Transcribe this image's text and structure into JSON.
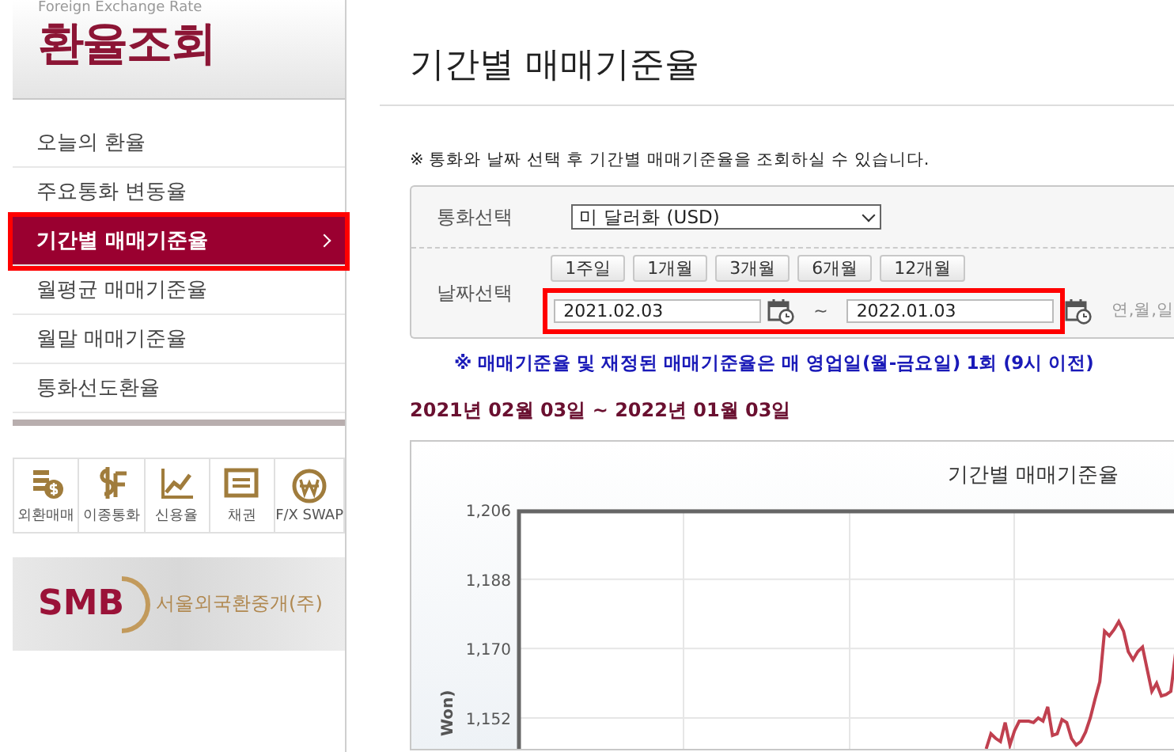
{
  "sidebar": {
    "header_subtitle": "Foreign Exchange Rate",
    "header_title": "환율조회",
    "menu": [
      {
        "label": "오늘의 환율",
        "selected": false,
        "highlighted": false
      },
      {
        "label": "주요통화 변동율",
        "selected": false,
        "highlighted": false
      },
      {
        "label": "기간별 매매기준율",
        "selected": true,
        "highlighted": true
      },
      {
        "label": "월평균 매매기준율",
        "selected": false,
        "highlighted": false
      },
      {
        "label": "월말 매매기준율",
        "selected": false,
        "highlighted": false
      },
      {
        "label": "통화선도환율",
        "selected": false,
        "highlighted": false
      }
    ],
    "quick_links": [
      {
        "label": "외환매매",
        "kind": "coins"
      },
      {
        "label": "이종통화",
        "kind": "currency"
      },
      {
        "label": "신용율",
        "kind": "chart"
      },
      {
        "label": "채권",
        "kind": "document"
      },
      {
        "label": "F/X SWAP",
        "kind": "won"
      }
    ],
    "banner": {
      "logo": "SMB",
      "name": "서울외국환중개(주)"
    }
  },
  "main": {
    "title": "기간별 매매기준율",
    "note": "※ 통화와 날짜 선택 후 기간별 매매기준율을 조회하실 수 있습니다.",
    "form": {
      "currency_label": "통화선택",
      "currency_value": "미 달러화 (USD)",
      "date_label": "날짜선택",
      "period_buttons": [
        "1주일",
        "1개월",
        "3개월",
        "6개월",
        "12개월"
      ],
      "start_date": "2021.02.03",
      "separator": "~",
      "end_date": "2022.01.03",
      "date_hint": "연,월,일",
      "dates_highlighted": true
    },
    "notice": "※ 매매기준율 및 재정된 매매기준율은 매 영업일(월-금요일) 1회 (9시 이전)",
    "range_text": "2021년 02월 03일 ~ 2022년 01월 03일",
    "chart": {
      "chart_data": {
        "type": "line",
        "title": "기간별 매매기준율",
        "ylabel": "Won)",
        "grid": true,
        "ylim": [
          1144,
          1206
        ],
        "yticks": [
          {
            "value": 1152,
            "label": "1,152"
          },
          {
            "value": 1170,
            "label": "1,170"
          },
          {
            "value": 1188,
            "label": "1,188"
          },
          {
            "value": 1206,
            "label": "1,206"
          }
        ],
        "categories": [
          null,
          null,
          null,
          null,
          null,
          null,
          null,
          null,
          null,
          null,
          null,
          null,
          null,
          null,
          null,
          null,
          null,
          null,
          null,
          null,
          null,
          null,
          null,
          null,
          null,
          null,
          null,
          null,
          null,
          null,
          null,
          null,
          null,
          null,
          null,
          null,
          null,
          null,
          null,
          null,
          null,
          null,
          null,
          null,
          null,
          null,
          null,
          null,
          null,
          null,
          null,
          null,
          null,
          null,
          null,
          null,
          null,
          null,
          null,
          null,
          null,
          null,
          null,
          null,
          null,
          null,
          null,
          null,
          null,
          null,
          null,
          null,
          null,
          null,
          null,
          null,
          null,
          null,
          null,
          null,
          null,
          null,
          null,
          null,
          null,
          null,
          null,
          null,
          null,
          null,
          null,
          null,
          null,
          null,
          null,
          null,
          null,
          null,
          null,
          null,
          null,
          null,
          null,
          null,
          null,
          null,
          null,
          null,
          null,
          null,
          null,
          null,
          null,
          null,
          null,
          null,
          null,
          null,
          null,
          null,
          null,
          null,
          null,
          null,
          null,
          null,
          null,
          null,
          null,
          null,
          null,
          null,
          null,
          null,
          null,
          null,
          null,
          null,
          null,
          null
        ],
        "series": [
          {
            "color": "#c0404f",
            "values": [
              null,
              null,
              null,
              null,
              null,
              null,
              null,
              null,
              null,
              null,
              null,
              null,
              null,
              null,
              null,
              null,
              null,
              null,
              null,
              null,
              null,
              null,
              null,
              null,
              null,
              null,
              null,
              null,
              null,
              null,
              null,
              null,
              null,
              null,
              null,
              null,
              null,
              null,
              null,
              null,
              null,
              null,
              null,
              null,
              null,
              null,
              null,
              null,
              null,
              null,
              null,
              null,
              null,
              null,
              null,
              null,
              null,
              null,
              null,
              null,
              null,
              null,
              null,
              null,
              null,
              null,
              null,
              null,
              null,
              null,
              null,
              null,
              null,
              null,
              null,
              null,
              null,
              null,
              null,
              null,
              null,
              null,
              null,
              null,
              null,
              null,
              null,
              null,
              null,
              null,
              null,
              null,
              null,
              null,
              null,
              null,
              null,
              null,
              null,
              1144.0,
              1147.9,
              1146.7,
              1145.9,
              1150.8,
              1145.0,
              1148.7,
              1151.2,
              1151.2,
              1151.2,
              1150.8,
              1152.0,
              1151.2,
              1154.9,
              1147.5,
              1147.9,
              1151.6,
              1150.8,
              1146.7,
              1145.0,
              1145.9,
              1148.3,
              1152.0,
              1156.9,
              1161.4,
              1174.5,
              1173.3,
              1174.9,
              1177.0,
              1174.5,
              1169.2,
              1167.1,
              1169.2,
              1170.4,
              1164.7,
              1158.9,
              1161.0,
              1157.7,
              1158.1,
              1158.9,
              1168.8
            ]
          }
        ]
      }
    }
  }
}
